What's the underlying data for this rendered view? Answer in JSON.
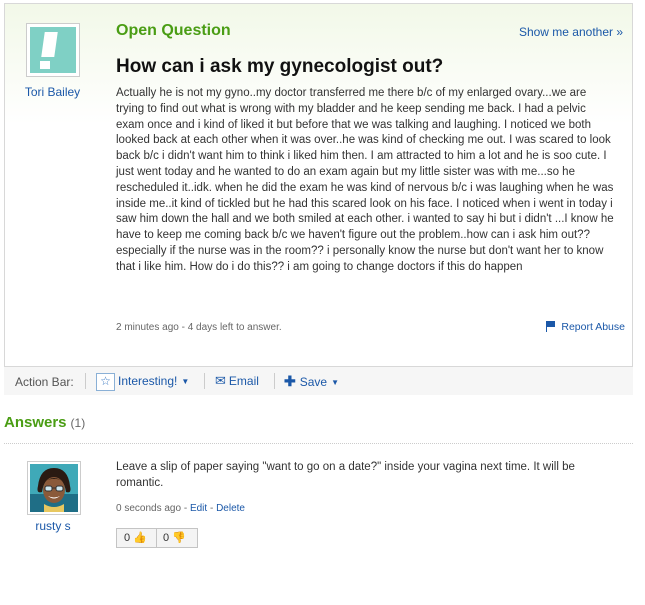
{
  "question": {
    "label": "Open Question",
    "show_another": "Show me another »",
    "asker": "Tori Bailey",
    "title": "How can i ask my gynecologist out?",
    "body": "Actually he is not my gyno..my doctor transferred me there b/c of my enlarged ovary...we are trying to find out what is wrong with my bladder and he keep sending me back. I had a pelvic exam once and i kind of liked it but before that we was talking and laughing. I noticed we both looked back at each other when it was over..he was kind of checking me out. I was scared to look back b/c i didn't want him to think i liked him then. I am attracted to him a lot and he is soo cute. I just went today and he wanted to do an exam again but my little sister was with me...so he rescheduled it..idk. when he did the exam he was kind of nervous b/c i was laughing when he was inside me..it kind of tickled but he had this scared look on his face. I noticed when i went in today i saw him down the hall and we both smiled at each other. i wanted to say hi but i didn't ...I know he have to keep me coming back b/c we haven't figure out the problem..how can i ask him out?? especially if the nurse was in the room?? i personally know the nurse but don't want her to know that i like him. How do i do this?? i am going to change doctors if this do happen",
    "meta": "2 minutes ago - 4 days left to answer.",
    "report_abuse": "Report Abuse"
  },
  "action_bar": {
    "label": "Action Bar:",
    "interesting": "Interesting!",
    "email": "Email",
    "save": "Save"
  },
  "answers": {
    "heading": "Answers",
    "count": "(1)",
    "items": [
      {
        "author": "rusty s",
        "body": "Leave a slip of paper saying \"want to go on a date?\" inside your vagina next time. It will be romantic.",
        "time": "0 seconds ago",
        "edit": "Edit",
        "delete": "Delete",
        "thumbs_up": "0",
        "thumbs_down": "0"
      }
    ]
  },
  "colors": {
    "accent_green": "#4a9d14",
    "link_blue": "#1b58a8"
  }
}
